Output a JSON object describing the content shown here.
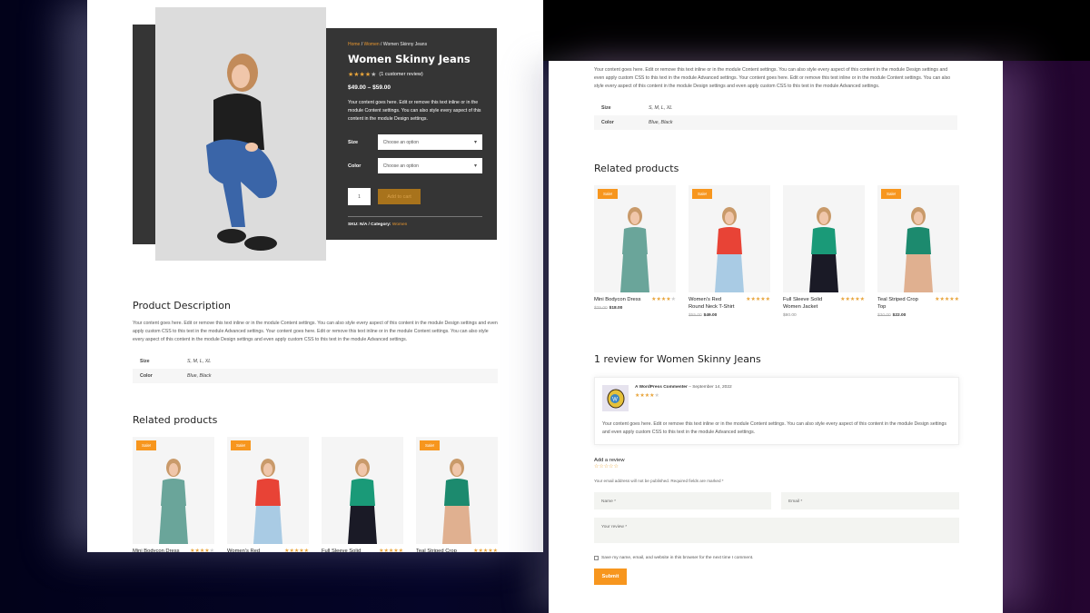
{
  "product": {
    "breadcrumb": [
      {
        "label": "Home",
        "link": true
      },
      {
        "label": "Women",
        "link": true
      },
      {
        "label": "Women Skinny Jeans",
        "link": false
      }
    ],
    "title": "Women Skinny Jeans",
    "rating": 4,
    "rating_max": 5,
    "review_link": "(1 customer review)",
    "price_range": "$49.00 – $59.00",
    "short_description": "Your content goes here. Edit or remove this text inline or in the module Content settings. You can also style every aspect of this content in the module Design settings.",
    "variations": [
      {
        "label": "Size",
        "value": "Choose an option"
      },
      {
        "label": "Color",
        "value": "Choose an option"
      }
    ],
    "quantity": "1",
    "add_to_cart": "Add to cart",
    "sku_label": "SKU: N/A / Category:",
    "category": "Women"
  },
  "description": {
    "heading": "Product Description",
    "text": "Your content goes here. Edit or remove this text inline or in the module Content settings. You can also style every aspect of this content in the module Design settings and even apply custom CSS to this text in the module Advanced settings. Your content goes here. Edit or remove this text inline or in the module Content settings. You can also style every aspect of this content in the module Design settings and even apply custom CSS to this text in the module Advanced settings.",
    "attributes": [
      {
        "name": "Size",
        "value": "S, M, L, XL"
      },
      {
        "name": "Color",
        "value": "Blue, Black"
      }
    ]
  },
  "related": {
    "heading": "Related products",
    "sale_label": "Sale!",
    "items": [
      {
        "name": "Mini Bodycon Dress",
        "rating": 4,
        "old_price": "$25.00",
        "price": "$18.00",
        "sale": true,
        "top": "#6aa59a",
        "bottom": "#6aa59a"
      },
      {
        "name": "Women's Red Round Neck T-Shirt",
        "rating": 5,
        "old_price": "$55.00",
        "price": "$49.00",
        "sale": true,
        "top": "#e84336",
        "bottom": "#a9cbe4"
      },
      {
        "name": "Full Sleeve Solid Women Jacket",
        "rating": 5,
        "old_price": "",
        "price": "$80.00",
        "sale": false,
        "top": "#1a9a78",
        "bottom": "#1a1a26"
      },
      {
        "name": "Teal Striped Crop Top",
        "rating": 5,
        "old_price": "$30.00",
        "price": "$22.00",
        "sale": true,
        "top": "#1c8a6e",
        "bottom": "#e0b090"
      }
    ]
  },
  "reviews": {
    "heading": "1 review for Women Skinny Jeans",
    "items": [
      {
        "author": "A WordPress Commenter",
        "date": "September 14, 2022",
        "rating": 4,
        "text": "Your content goes here. Edit or remove this text inline or in the module Content settings. You can also style every aspect of this content in the module Design settings and even apply custom CSS to this text in the module Advanced settings."
      }
    ],
    "form": {
      "title": "Add a review",
      "note": "Your email address will not be published. Required fields are marked *",
      "name_placeholder": "Name *",
      "email_placeholder": "Email *",
      "review_placeholder": "Your review *",
      "save_label": "Save my name, email, and website in this browser for the next time I comment.",
      "submit": "Submit"
    }
  },
  "colors": {
    "accent": "#f7961e",
    "dark_panel": "#353535",
    "star": "#e8a43a"
  }
}
